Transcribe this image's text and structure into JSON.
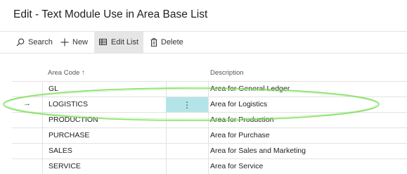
{
  "page": {
    "title": "Edit - Text Module Use in Area Base List"
  },
  "toolbar": {
    "search_label": "Search",
    "new_label": "New",
    "edit_list_label": "Edit List",
    "delete_label": "Delete"
  },
  "columns": {
    "area_code": "Area Code",
    "sort_indicator": "↑",
    "description": "Description"
  },
  "rows": [
    {
      "code": "GL",
      "description": "Area for General Ledger"
    },
    {
      "code": "LOGISTICS",
      "description": "Area for Logistics"
    },
    {
      "code": "PRODUCTION",
      "description": "Area for Production"
    },
    {
      "code": "PURCHASE",
      "description": "Area for Purchase"
    },
    {
      "code": "SALES",
      "description": "Area for Sales and Marketing"
    },
    {
      "code": "SERVICE",
      "description": "Area for Service"
    }
  ],
  "selection": {
    "row_arrow": "→",
    "row_menu": "⋮"
  },
  "colors": {
    "selected_cell": "#b3e5e8",
    "annotation_ellipse": "#7cdc5a"
  },
  "icons": {
    "search": "search-icon",
    "new": "plus-icon",
    "edit_list": "edit-list-icon",
    "delete": "trash-icon"
  }
}
